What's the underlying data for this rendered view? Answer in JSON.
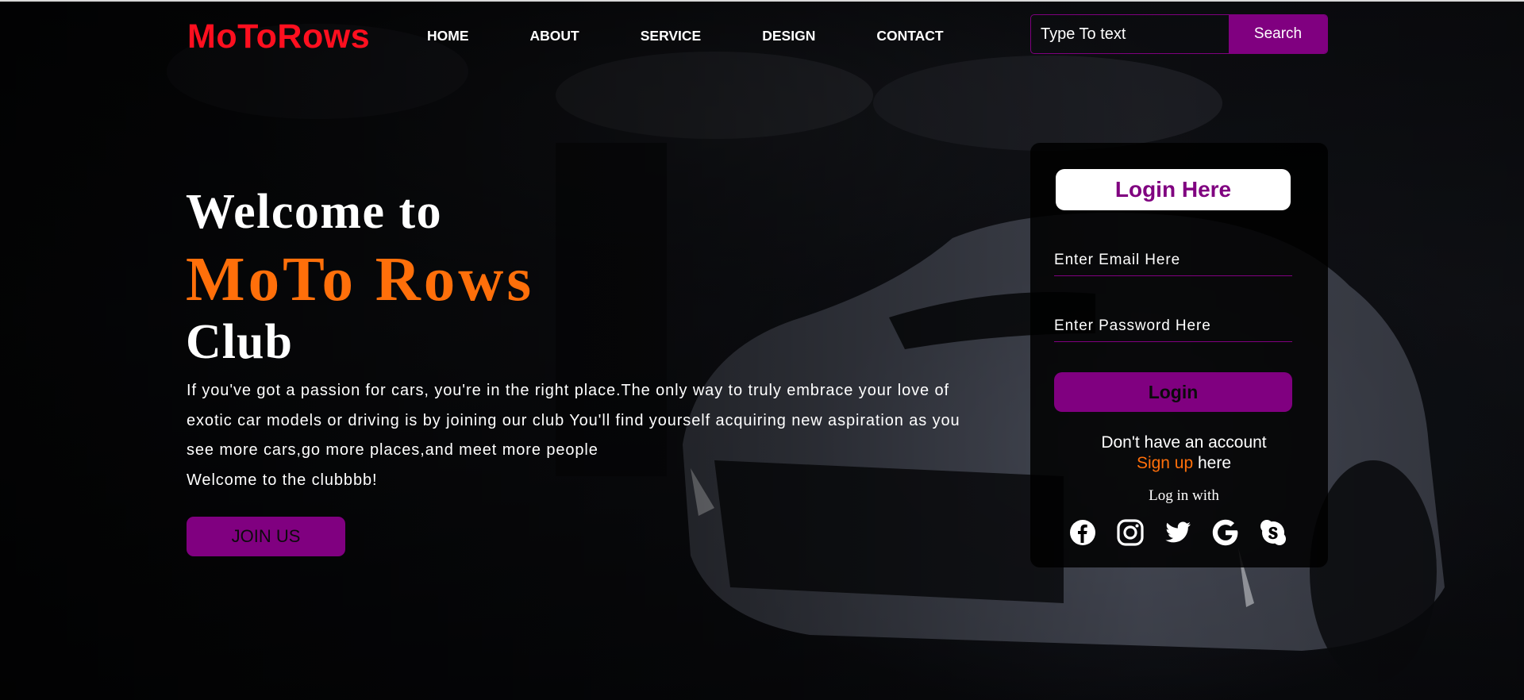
{
  "header": {
    "logo": "MoToRows",
    "nav": [
      "HOME",
      "ABOUT",
      "SERVICE",
      "DESIGN",
      "CONTACT"
    ],
    "search_placeholder": "Type To text",
    "search_button": "Search"
  },
  "hero": {
    "line1": "Welcome to",
    "line2": "MoTo Rows",
    "line3": "Club",
    "paragraph_lines": [
      "If you've got a passion for cars, you're in the right place.The only way to truly embrace your love of",
      "exotic car models or driving is by joining our club You'll find yourself acquiring new aspiration as you",
      "see more cars,go more places,and meet more people",
      "Welcome to the clubbbb!"
    ],
    "join_button": "JOIN US"
  },
  "login": {
    "title": "Login Here",
    "email_placeholder": "Enter Email Here",
    "password_placeholder": "Enter Password Here",
    "login_button": "Login",
    "no_account_text": "Don't have an account",
    "signup_link": "Sign up",
    "signup_suffix": " here",
    "login_with": "Log in with",
    "socials": [
      "facebook-icon",
      "instagram-icon",
      "twitter-icon",
      "google-icon",
      "skype-icon"
    ]
  },
  "colors": {
    "logo": "#ff0f1f",
    "accent_purple": "#800080",
    "accent_orange": "#ff6f0a"
  }
}
